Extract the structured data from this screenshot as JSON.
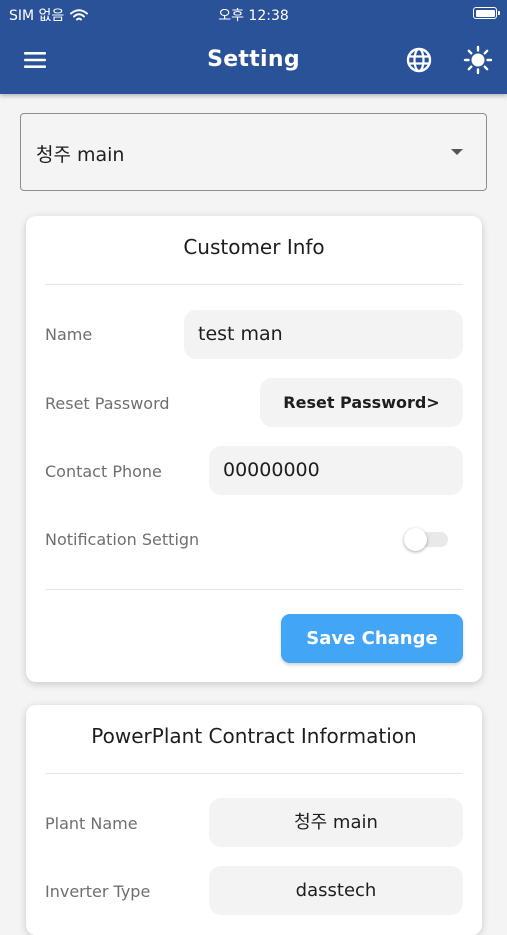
{
  "status_bar": {
    "carrier": "SIM 없음",
    "time": "오후 12:38"
  },
  "app_bar": {
    "title": "Setting",
    "menu_icon": "menu-icon",
    "language_icon": "globe-icon",
    "theme_icon": "brightness-icon"
  },
  "plant_selector": {
    "value": "청주 main"
  },
  "customer_info": {
    "title": "Customer Info",
    "name_label": "Name",
    "name_value": "test man",
    "reset_label": "Reset Password",
    "reset_button": "Reset Password>",
    "phone_label": "Contact Phone",
    "phone_value": "00000000",
    "notification_label": "Notification Settign",
    "notification_enabled": false,
    "save_button": "Save Change"
  },
  "contract_info": {
    "title": "PowerPlant Contract Information",
    "plant_name_label": "Plant Name",
    "plant_name_value": "청주 main",
    "inverter_label": "Inverter Type",
    "inverter_value": "dasstech"
  },
  "colors": {
    "primary": "#2a5298",
    "accent_button": "#42a5f5",
    "background": "#f4f4f4",
    "card": "#ffffff"
  }
}
